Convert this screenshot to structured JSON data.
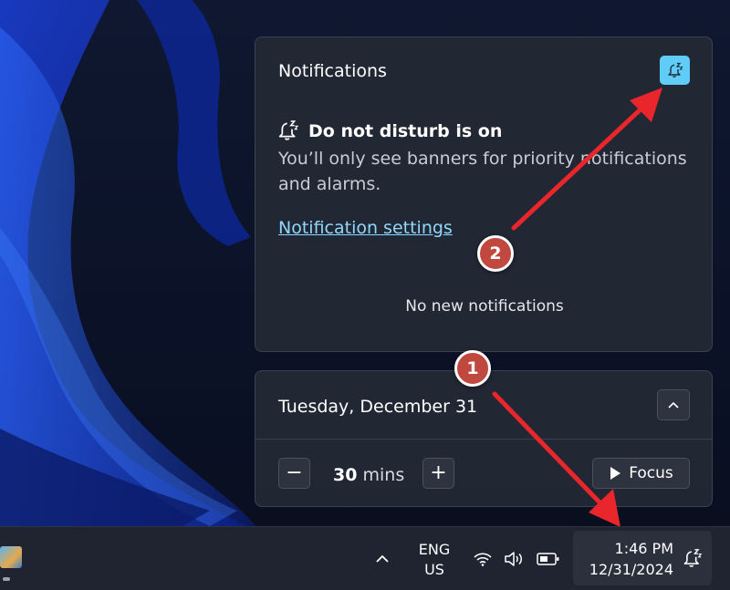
{
  "notifications": {
    "title": "Notifications",
    "dnd_toggle_icon": "bell-snooze-icon",
    "dnd_heading": "Do not disturb is on",
    "dnd_description": "You’ll only see banners for priority notifications and alarms.",
    "settings_link": "Notification settings",
    "empty_message": "No new notifications"
  },
  "calendar": {
    "date_label": "Tuesday, December 31",
    "collapse_icon": "chevron-up-icon"
  },
  "focus": {
    "minus_label": "−",
    "plus_label": "+",
    "duration_value": "30",
    "duration_unit": "mins",
    "focus_button_label": "Focus",
    "focus_button_icon": "play-icon"
  },
  "markers": {
    "one": "1",
    "two": "2"
  },
  "taskbar": {
    "language_line1": "ENG",
    "language_line2": "US",
    "time": "1:46 PM",
    "date": "12/31/2024",
    "tray_icons": [
      "chevron-up-icon",
      "wifi-icon",
      "speaker-icon",
      "battery-icon",
      "bell-snooze-icon"
    ]
  },
  "colors": {
    "accent": "#5fcdf8",
    "link": "#8fd8ff",
    "marker": "#c0483f",
    "arrow": "#e8262b",
    "panel_bg": "#23283a"
  }
}
